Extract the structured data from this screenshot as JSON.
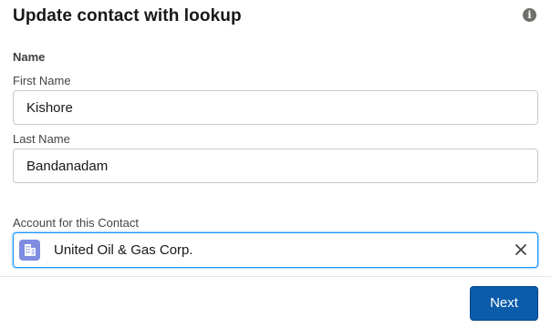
{
  "header": {
    "title": "Update contact with lookup",
    "info_icon": "info-icon",
    "info_glyph": "i"
  },
  "name_section": {
    "label": "Name",
    "first_name": {
      "label": "First Name",
      "value": "Kishore"
    },
    "last_name": {
      "label": "Last Name",
      "value": "Bandanadam"
    }
  },
  "account_lookup": {
    "label": "Account for this Contact",
    "value": "United Oil & Gas Corp.",
    "icon": "account-icon",
    "clear_icon": "close-icon",
    "icon_color": "#7f8de1",
    "focus_color": "#1b96ff"
  },
  "footer": {
    "next_label": "Next",
    "button_color": "#0b5cab"
  }
}
